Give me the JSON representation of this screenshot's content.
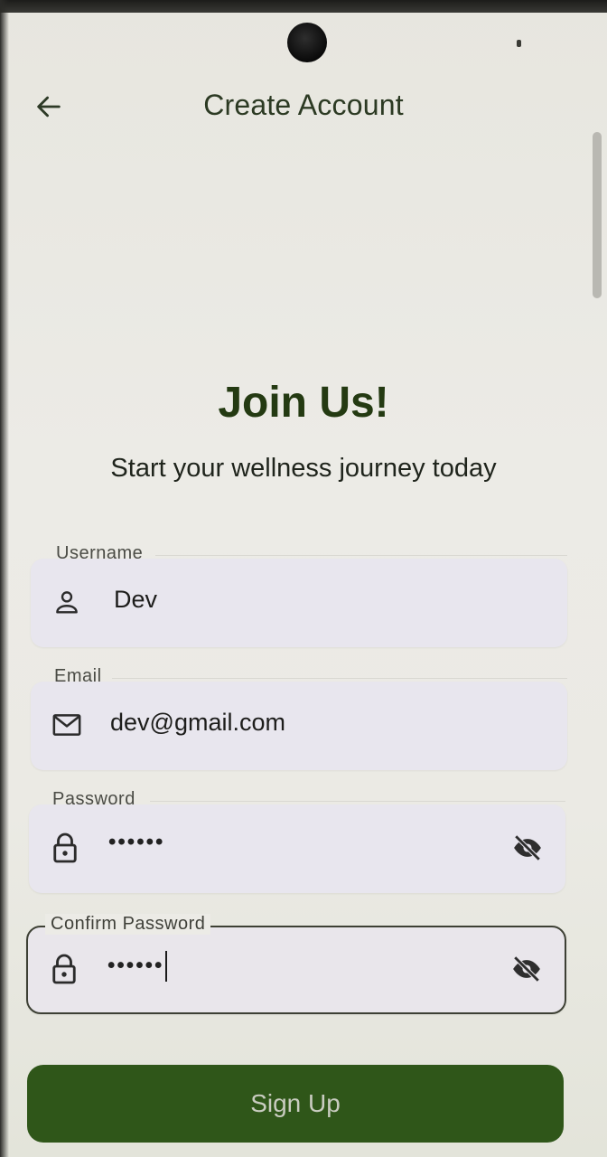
{
  "appbar": {
    "title": "Create Account",
    "back_icon": "arrow-left-icon"
  },
  "header": {
    "title": "Join Us!",
    "subtitle": "Start your wellness journey today"
  },
  "form": {
    "username": {
      "label": "Username",
      "value": "Dev",
      "icon": "person-icon"
    },
    "email": {
      "label": "Email",
      "value": "dev@gmail.com",
      "icon": "mail-icon"
    },
    "password": {
      "label": "Password",
      "masked_value": "••••••",
      "icon": "lock-icon",
      "toggle_icon": "eye-off-icon"
    },
    "confirm_password": {
      "label": "Confirm Password",
      "masked_value": "••••••",
      "icon": "lock-icon",
      "toggle_icon": "eye-off-icon",
      "focused": true
    }
  },
  "actions": {
    "signup_label": "Sign Up"
  },
  "colors": {
    "primary": "#2f5619",
    "heading": "#243a12",
    "field_bg": "#e8e6ee"
  }
}
